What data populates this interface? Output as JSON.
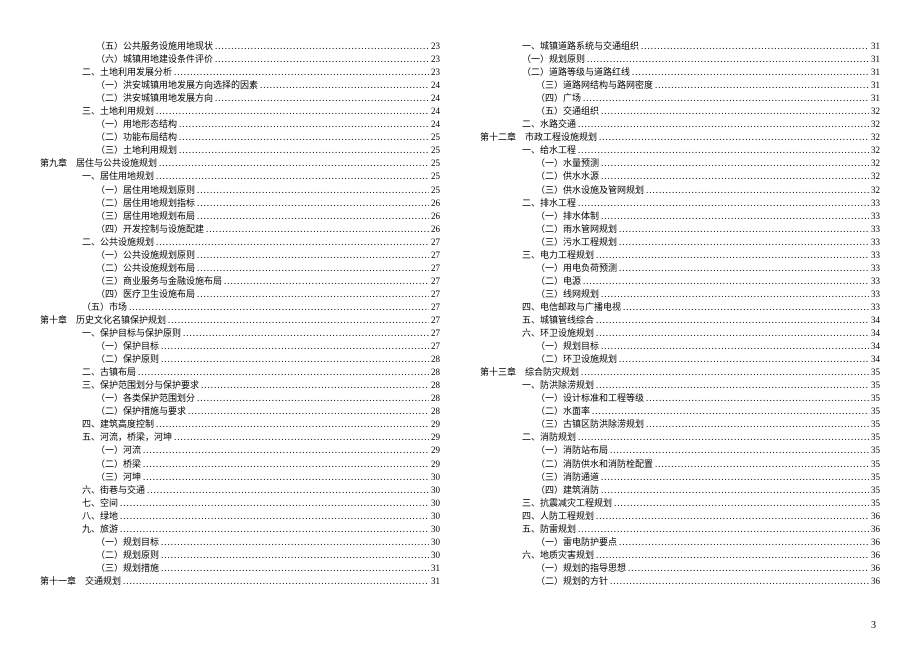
{
  "page_number": "3",
  "left_column": [
    {
      "indent": 3,
      "label": "（五）公共服务设施用地现状",
      "page": "23"
    },
    {
      "indent": 3,
      "label": "（六）城镇用地建设条件评价",
      "page": "23"
    },
    {
      "indent": 2,
      "label": "二、土地利用发展分析",
      "page": "23"
    },
    {
      "indent": 3,
      "label": "（一）洪安城镇用地发展方向选择的因素",
      "page": "24"
    },
    {
      "indent": 3,
      "label": "（二）洪安城镇用地发展方向",
      "page": "24"
    },
    {
      "indent": 2,
      "label": "三、土地利用规划",
      "page": "24"
    },
    {
      "indent": 3,
      "label": "（一）用地形态结构",
      "page": "24"
    },
    {
      "indent": 3,
      "label": "（二）功能布局结构",
      "page": "25"
    },
    {
      "indent": 3,
      "label": "（三）土地利用规划",
      "page": "25"
    },
    {
      "indent": 0,
      "label": "第九章　居住与公共设施规划",
      "page": "25"
    },
    {
      "indent": 2,
      "label": "一、居住用地规划",
      "page": "25"
    },
    {
      "indent": 3,
      "label": "（一）居住用地规划原则",
      "page": "25"
    },
    {
      "indent": 3,
      "label": "（二）居住用地规划指标",
      "page": "26"
    },
    {
      "indent": 3,
      "label": "（三）居住用地规划布局",
      "page": "26"
    },
    {
      "indent": 3,
      "label": "（四）开发控制与设施配建",
      "page": "26"
    },
    {
      "indent": 2,
      "label": "二、公共设施规划",
      "page": "27"
    },
    {
      "indent": 3,
      "label": "（一）公共设施规划原则",
      "page": "27"
    },
    {
      "indent": 3,
      "label": "（二）公共设施规划布局",
      "page": "27"
    },
    {
      "indent": 3,
      "label": "（三）商业服务与金融设施布局",
      "page": "27"
    },
    {
      "indent": 3,
      "label": "（四）医疗卫生设施布局",
      "page": "27"
    },
    {
      "indent": 2,
      "label": "（五）市场",
      "page": "27"
    },
    {
      "indent": 0,
      "label": "第十章　历史文化名镇保护规划",
      "page": "27"
    },
    {
      "indent": 2,
      "label": "一、保护目标与保护原则",
      "page": "27"
    },
    {
      "indent": 3,
      "label": "（一）保护目标",
      "page": "27"
    },
    {
      "indent": 3,
      "label": "（二）保护原则",
      "page": "28"
    },
    {
      "indent": 2,
      "label": "二、古镇布局",
      "page": "28"
    },
    {
      "indent": 2,
      "label": "三、保护范围划分与保护要求",
      "page": "28"
    },
    {
      "indent": 3,
      "label": "（一）各类保护范围划分",
      "page": "28"
    },
    {
      "indent": 3,
      "label": "（二）保护措施与要求",
      "page": "28"
    },
    {
      "indent": 2,
      "label": "四、建筑高度控制",
      "page": "29"
    },
    {
      "indent": 2,
      "label": "五、河流，桥梁，河坤",
      "page": "29"
    },
    {
      "indent": 3,
      "label": "（一）河流",
      "page": "29"
    },
    {
      "indent": 3,
      "label": "（二）桥梁",
      "page": "29"
    },
    {
      "indent": 3,
      "label": "（三）河坤",
      "page": "30"
    },
    {
      "indent": 2,
      "label": "六、街巷与交通",
      "page": "30"
    },
    {
      "indent": 2,
      "label": "七、空间",
      "page": "30"
    },
    {
      "indent": 2,
      "label": "八、绿地",
      "page": "30"
    },
    {
      "indent": 2,
      "label": "九、旅游",
      "page": "30"
    },
    {
      "indent": 3,
      "label": "（一）规划目标",
      "page": "30"
    },
    {
      "indent": 3,
      "label": "（二）规划原则",
      "page": "30"
    },
    {
      "indent": 3,
      "label": "（三）规划措施",
      "page": "31"
    },
    {
      "indent": 0,
      "label": "第十一章　交通规划",
      "page": "31"
    }
  ],
  "right_column": [
    {
      "indent": 2,
      "label": "一、城镇道路系统与交通组织",
      "page": "31"
    },
    {
      "indent": 2,
      "label": "（一）规划原则",
      "page": "31"
    },
    {
      "indent": 2,
      "label": "（二）道路等级与道路红线",
      "page": "31"
    },
    {
      "indent": 3,
      "label": "（三）道路网结构与路网密度",
      "page": "31"
    },
    {
      "indent": 3,
      "label": "（四）广场",
      "page": "31"
    },
    {
      "indent": 3,
      "label": "（五）交通组织",
      "page": "32"
    },
    {
      "indent": 2,
      "label": "二、水路交通",
      "page": "32"
    },
    {
      "indent": 0,
      "label": "第十二章　市政工程设施规划",
      "page": "32"
    },
    {
      "indent": 2,
      "label": "一、给水工程",
      "page": "32"
    },
    {
      "indent": 3,
      "label": "（一）水量预测",
      "page": "32"
    },
    {
      "indent": 3,
      "label": "（二）供水水源",
      "page": "32"
    },
    {
      "indent": 3,
      "label": "（三）供水设施及管网规划",
      "page": "32"
    },
    {
      "indent": 2,
      "label": "二、排水工程",
      "page": "33"
    },
    {
      "indent": 3,
      "label": "（一）排水体制",
      "page": "33"
    },
    {
      "indent": 3,
      "label": "（二）雨水管网规划",
      "page": "33"
    },
    {
      "indent": 3,
      "label": "（三）污水工程规划",
      "page": "33"
    },
    {
      "indent": 2,
      "label": "三、电力工程规划",
      "page": "33"
    },
    {
      "indent": 3,
      "label": "（一）用电负荷预测",
      "page": "33"
    },
    {
      "indent": 3,
      "label": "（二）电源",
      "page": "33"
    },
    {
      "indent": 3,
      "label": "（三）线网规划",
      "page": "33"
    },
    {
      "indent": 2,
      "label": "四、电信邮政与广播电视",
      "page": "33"
    },
    {
      "indent": 2,
      "label": "五、城镇管线综合",
      "page": "34"
    },
    {
      "indent": 2,
      "label": "六、环卫设施规划",
      "page": "34"
    },
    {
      "indent": 3,
      "label": "（一）规划目标",
      "page": "34"
    },
    {
      "indent": 3,
      "label": "（二）环卫设施规划",
      "page": "34"
    },
    {
      "indent": 0,
      "label": "第十三章　综合防灾规划",
      "page": "35"
    },
    {
      "indent": 2,
      "label": "一、防洪除涝规划",
      "page": "35"
    },
    {
      "indent": 3,
      "label": "（一）设计标准和工程等级",
      "page": "35"
    },
    {
      "indent": 3,
      "label": "（二）水面率",
      "page": "35"
    },
    {
      "indent": 3,
      "label": "（三）古镇区防洪除涝规划",
      "page": "35"
    },
    {
      "indent": 2,
      "label": "二、消防规划",
      "page": "35"
    },
    {
      "indent": 3,
      "label": "（一）消防站布局",
      "page": "35"
    },
    {
      "indent": 3,
      "label": "（二）消防供水和消防栓配置",
      "page": "35"
    },
    {
      "indent": 3,
      "label": "（三）消防通道",
      "page": "35"
    },
    {
      "indent": 3,
      "label": "（四）建筑消防",
      "page": "35"
    },
    {
      "indent": 2,
      "label": "三、抗震减灾工程规划",
      "page": "35"
    },
    {
      "indent": 2,
      "label": "四、人防工程规划",
      "page": "36"
    },
    {
      "indent": 2,
      "label": "五、防雷规划",
      "page": "36"
    },
    {
      "indent": 3,
      "label": "（一）雷电防护要点",
      "page": "36"
    },
    {
      "indent": 2,
      "label": "六、地质灾害规划",
      "page": "36"
    },
    {
      "indent": 3,
      "label": "（一）规划的指导思想",
      "page": "36"
    },
    {
      "indent": 3,
      "label": "（二）规划的方针",
      "page": "36"
    }
  ]
}
